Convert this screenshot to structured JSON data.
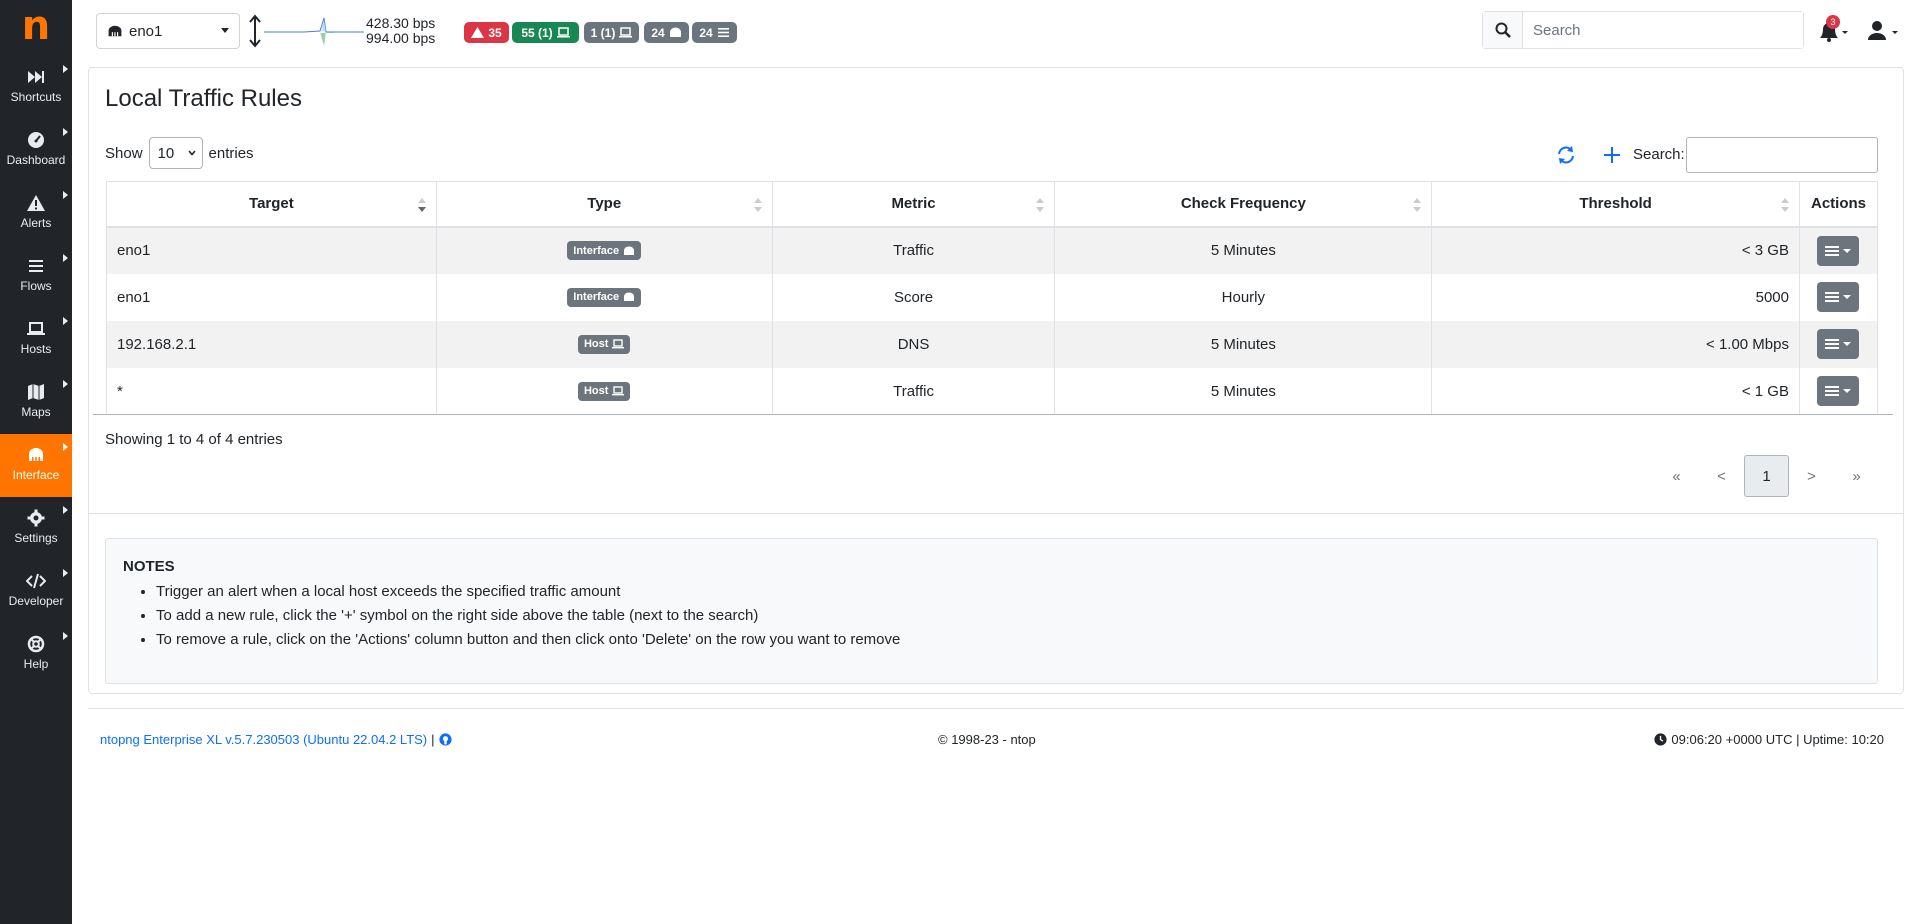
{
  "sidebar": {
    "logo": "n",
    "items": [
      {
        "label": "Shortcuts",
        "icon": "fast-forward-icon"
      },
      {
        "label": "Dashboard",
        "icon": "gauge-icon"
      },
      {
        "label": "Alerts",
        "icon": "warning-icon"
      },
      {
        "label": "Flows",
        "icon": "stream-icon"
      },
      {
        "label": "Hosts",
        "icon": "laptop-icon"
      },
      {
        "label": "Maps",
        "icon": "map-icon"
      },
      {
        "label": "Interface",
        "icon": "ethernet-icon",
        "active": true
      },
      {
        "label": "Settings",
        "icon": "gear-icon"
      },
      {
        "label": "Developer",
        "icon": "code-icon"
      },
      {
        "label": "Help",
        "icon": "life-ring-icon"
      }
    ]
  },
  "topbar": {
    "interface": "eno1",
    "rate_up": "428.30 bps",
    "rate_down": "994.00 bps",
    "badges": {
      "alerts": "35",
      "hosts": "55 (1)",
      "remote_hosts": "1 (1)",
      "devices": "24",
      "flows": "24"
    },
    "search_placeholder": "Search",
    "notification_count": "3"
  },
  "page": {
    "title": "Local Traffic Rules",
    "show_label": "Show",
    "entries_value": "10",
    "entries_label": "entries",
    "search_label": "Search:",
    "columns": [
      "Target",
      "Type",
      "Metric",
      "Check Frequency",
      "Threshold",
      "Actions"
    ],
    "rows": [
      {
        "target": "eno1",
        "type": "Interface",
        "metric": "Traffic",
        "frequency": "5 Minutes",
        "threshold": "< 3 GB"
      },
      {
        "target": "eno1",
        "type": "Interface",
        "metric": "Score",
        "frequency": "Hourly",
        "threshold": "5000"
      },
      {
        "target": "192.168.2.1",
        "type": "Host",
        "metric": "DNS",
        "frequency": "5 Minutes",
        "threshold": "< 1.00 Mbps"
      },
      {
        "target": "*",
        "type": "Host",
        "metric": "Traffic",
        "frequency": "5 Minutes",
        "threshold": "< 1 GB"
      }
    ],
    "info": "Showing 1 to 4 of 4 entries",
    "pager": {
      "first": "«",
      "prev": "<",
      "current": "1",
      "next": ">",
      "last": "»"
    }
  },
  "notes": {
    "title": "NOTES",
    "items": [
      "Trigger an alert when a local host exceeds the specified traffic amount",
      "To add a new rule, click the '+' symbol on the right side above the table (next to the search)",
      "To remove a rule, click on the 'Actions' column button and then click onto 'Delete' on the row you want to remove"
    ]
  },
  "footer": {
    "version": "ntopng Enterprise XL v.5.7.230503 (Ubuntu 22.04.2 LTS)",
    "pipe": "|",
    "copyright": "© 1998-23 - ntop",
    "time": "09:06:20 +0000 UTC | Uptime: 10:20"
  },
  "colors": {
    "accent": "#ff7500",
    "sidebar": "#212529",
    "danger": "#dc3545",
    "success": "#198754",
    "secondary": "#6c757d",
    "link": "#0d6efd"
  }
}
